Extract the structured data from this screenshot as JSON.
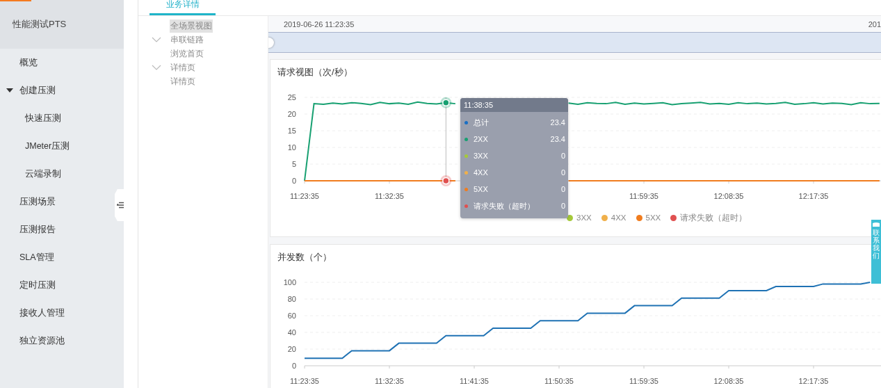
{
  "sidebar": {
    "title": "性能测试PTS",
    "items": [
      {
        "label": "概览"
      },
      {
        "label": "创建压测",
        "expanded": true,
        "children": [
          {
            "label": "快速压测"
          },
          {
            "label": "JMeter压测"
          },
          {
            "label": "云端录制"
          }
        ]
      },
      {
        "label": "压测场景"
      },
      {
        "label": "压测报告"
      },
      {
        "label": "SLA管理"
      },
      {
        "label": "定时压测"
      },
      {
        "label": "接收人管理"
      },
      {
        "label": "独立资源池"
      }
    ]
  },
  "tabs": [
    {
      "label": "业务详情",
      "selected": true
    }
  ],
  "scene_tree": [
    {
      "label": "全场景视图",
      "selected": true
    },
    {
      "label": "串联链路",
      "selected": false,
      "expanded": true,
      "children": [
        {
          "label": "浏览首页",
          "selected": false
        }
      ]
    },
    {
      "label": "详情页",
      "selected": false,
      "expanded": true,
      "children": [
        {
          "label": "详情页",
          "selected": false
        }
      ]
    }
  ],
  "time_range": {
    "start": "2019-06-26 11:23:35",
    "end": "201"
  },
  "panels": [
    {
      "title": "请求视图（次/秒）",
      "chart_data": {
        "type": "line",
        "grid": true,
        "categories": [
          "11:23:35",
          null,
          null,
          null,
          null,
          null,
          null,
          null,
          null,
          "11:32:35",
          null,
          null,
          null,
          null,
          null,
          null,
          null,
          null,
          null,
          null,
          null,
          null,
          null,
          null,
          null,
          null,
          null,
          null,
          null,
          null,
          null,
          null,
          null,
          null,
          null,
          null,
          "11:59:35",
          null,
          null,
          null,
          null,
          null,
          null,
          null,
          null,
          "12:08:35",
          null,
          null,
          null,
          null,
          null,
          null,
          null,
          null,
          "12:17:35",
          null,
          null,
          null,
          null,
          null,
          null,
          null
        ],
        "ylim": [
          0,
          25
        ],
        "yticks": [
          0,
          5,
          10,
          15,
          20,
          25
        ],
        "series": [
          {
            "color": "#17a071",
            "values": [
              0,
              23.1,
              22.9,
              23.3,
              23.0,
              23.4,
              23.2,
              22.8,
              23.5,
              23.1,
              23.3,
              22.9,
              23.6,
              23.2,
              23.0,
              23.4,
              23.1,
              null,
              null,
              null,
              null,
              null,
              null,
              null,
              null,
              null,
              null,
              null,
              23.3,
              22.9,
              23.4,
              23.2,
              23.1,
              23.5,
              22.9,
              23.3,
              23.0,
              23.2,
              23.4,
              22.8,
              23.1,
              23.3,
              23.5,
              23.0,
              23.2,
              22.9,
              23.4,
              23.1,
              23.3,
              23.0,
              23.2,
              23.5,
              22.9,
              23.1,
              23.4,
              23.0,
              23.3,
              23.2,
              22.8,
              23.4,
              23.1,
              23.2
            ]
          },
          {
            "color": "#f07c1e",
            "values": [
              0,
              0,
              0,
              0,
              0,
              0,
              0,
              0,
              0,
              0,
              0,
              0,
              0,
              0,
              0,
              0,
              0,
              null,
              null,
              null,
              null,
              null,
              null,
              null,
              null,
              null,
              null,
              null,
              0,
              0,
              0,
              0,
              0,
              0,
              0,
              0,
              0,
              0,
              0,
              0,
              0,
              0,
              0,
              0,
              0,
              0,
              0,
              0,
              0,
              0,
              0,
              0,
              0,
              0,
              0,
              0,
              0,
              0,
              0,
              0,
              0,
              0
            ]
          }
        ]
      },
      "legend": [
        {
          "name": "3XX",
          "color": "#a5c93a"
        },
        {
          "name": "4XX",
          "color": "#f0b04a"
        },
        {
          "name": "5XX",
          "color": "#f07c1e"
        },
        {
          "name": "请求失败（超时）",
          "color": "#e05050"
        }
      ],
      "tooltip": {
        "title": "11:38:35",
        "rows": [
          {
            "name": "总计",
            "value": "23.4",
            "color": "#1a6fc4"
          },
          {
            "name": "2XX",
            "value": "23.4",
            "color": "#17a071"
          },
          {
            "name": "3XX",
            "value": "0",
            "color": "#a5c93a"
          },
          {
            "name": "4XX",
            "value": "0",
            "color": "#f0b04a"
          },
          {
            "name": "5XX",
            "value": "0",
            "color": "#f07c1e"
          },
          {
            "name": "请求失败（超时）",
            "value": "0",
            "color": "#e05050"
          }
        ]
      }
    },
    {
      "title": "并发数（个）",
      "chart_data": {
        "type": "line",
        "grid": true,
        "categories": [
          "11:23:35",
          null,
          null,
          null,
          null,
          null,
          null,
          null,
          null,
          "11:32:35",
          null,
          null,
          null,
          null,
          null,
          null,
          null,
          null,
          "11:41:35",
          null,
          null,
          null,
          null,
          null,
          null,
          null,
          null,
          "11:50:35",
          null,
          null,
          null,
          null,
          null,
          null,
          null,
          null,
          "11:59:35",
          null,
          null,
          null,
          null,
          null,
          null,
          null,
          null,
          "12:08:35",
          null,
          null,
          null,
          null,
          null,
          null,
          null,
          null,
          "12:17:35",
          null,
          null,
          null,
          null,
          null,
          null,
          null
        ],
        "ylim": [
          0,
          100
        ],
        "yticks": [
          0,
          20,
          40,
          60,
          80,
          100
        ],
        "series": [
          {
            "color": "#1f72b4",
            "values": [
              9,
              9,
              9,
              9,
              9,
              18,
              18,
              18,
              18,
              18,
              27,
              27,
              27,
              27,
              27,
              36,
              36,
              36,
              36,
              36,
              45,
              45,
              45,
              45,
              45,
              54,
              54,
              54,
              54,
              54,
              63,
              63,
              63,
              63,
              63,
              72,
              72,
              72,
              72,
              72,
              81,
              81,
              81,
              81,
              81,
              90,
              90,
              90,
              90,
              90,
              95,
              95,
              95,
              95,
              95,
              98,
              98,
              98,
              98,
              98,
              100,
              null
            ]
          }
        ]
      }
    }
  ],
  "contact_tab": {
    "label": "联系我们"
  }
}
